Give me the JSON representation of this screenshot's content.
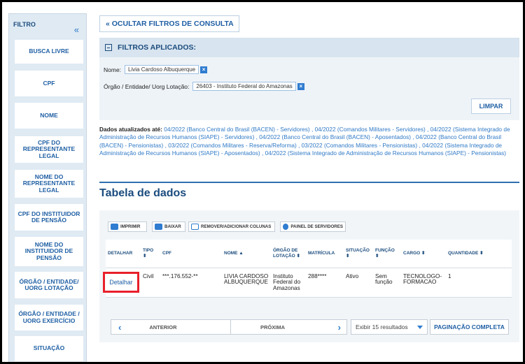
{
  "sidebar": {
    "title": "FILTRO",
    "collapse_icon": "«",
    "items": [
      {
        "label": "BUSCA LIVRE"
      },
      {
        "label": "CPF"
      },
      {
        "label": "NOME"
      },
      {
        "label": "CPF DO REPRESENTANTE LEGAL"
      },
      {
        "label": "NOME DO REPRESENTANTE LEGAL"
      },
      {
        "label": "CPF DO INSTITUIDOR DE PENSÃO"
      },
      {
        "label": "NOME DO INSTITUIDOR DE PENSÃO"
      },
      {
        "label": "ÓRGÃO / ENTIDADE/ UORG LOTAÇÃO"
      },
      {
        "label": "ÓRGÃO / ENTIDADE / UORG EXERCÍCIO"
      },
      {
        "label": "SITUAÇÃO"
      }
    ]
  },
  "filters": {
    "hide_label": "« OCULTAR FILTROS DE CONSULTA",
    "applied_title": "FILTROS APLICADOS:",
    "nome_label": "Nome:",
    "nome_value": "Livia Cardoso Albuquerque",
    "orgao_label": "Órgão / Entidade/ Uorg Lotação:",
    "orgao_value": "26403 - Instituto Federal do Amazonas",
    "remove_icon": "×",
    "clear_label": "LIMPAR"
  },
  "updated": {
    "label": "Dados atualizados até:",
    "text": "04/2022 (Banco Central do Brasil (BACEN) - Servidores) , 04/2022 (Comandos Militares - Servidores) , 04/2022 (Sistema Integrado de Administração de Recursos Humanos (SIAPE) - Servidores) , 04/2022 (Banco Central do Brasil (BACEN) - Aposentados) , 04/2022 (Banco Central do Brasil (BACEN) - Pensionistas) , 03/2022 (Comandos Militares - Reserva/Reforma) , 03/2022 (Comandos Militares - Pensionistas) , 04/2022 (Sistema Integrado de Administração de Recursos Humanos (SIAPE) - Aposentados) , 04/2022 (Sistema Integrado de Administração de Recursos Humanos (SIAPE) - Pensionistas)"
  },
  "table": {
    "title": "Tabela de dados",
    "toolbar": {
      "print": "IMPRIMIR",
      "download": "BAIXAR",
      "columns": "REMOVER/ADICIONAR COLUNAS",
      "panel": "PAINEL DE SERVIDORES"
    },
    "headers": {
      "detalhar": "DETALHAR",
      "tipo": "TIPO ⬍",
      "cpf": "CPF",
      "nome": "NOME ▲",
      "orgao": "ÓRGÃO DE LOTAÇÃO ⬍",
      "matricula": "MATRÍCULA",
      "situacao": "SITUAÇÃO ⬍",
      "funcao": "FUNÇÃO ⬍",
      "cargo": "CARGO ⬍",
      "quantidade": "QUANTIDADE ⬍"
    },
    "row": {
      "detalhar": "Detalhar",
      "tipo": "Civil",
      "cpf": "***.176.552-**",
      "nome": "LIVIA CARDOSO ALBUQUERQUE",
      "orgao": "Instituto Federal do Amazonas",
      "matricula": "288****",
      "situacao": "Ativo",
      "funcao": "Sem função",
      "cargo": "TECNOLOGO-FORMACAO",
      "quantidade": "1"
    },
    "pager": {
      "prev_icon": "‹",
      "prev": "ANTERIOR",
      "next": "PRÓXIMA",
      "next_icon": "›",
      "page_size": "Exibir 15 resultados",
      "full": "PAGINAÇÃO COMPLETA"
    }
  }
}
